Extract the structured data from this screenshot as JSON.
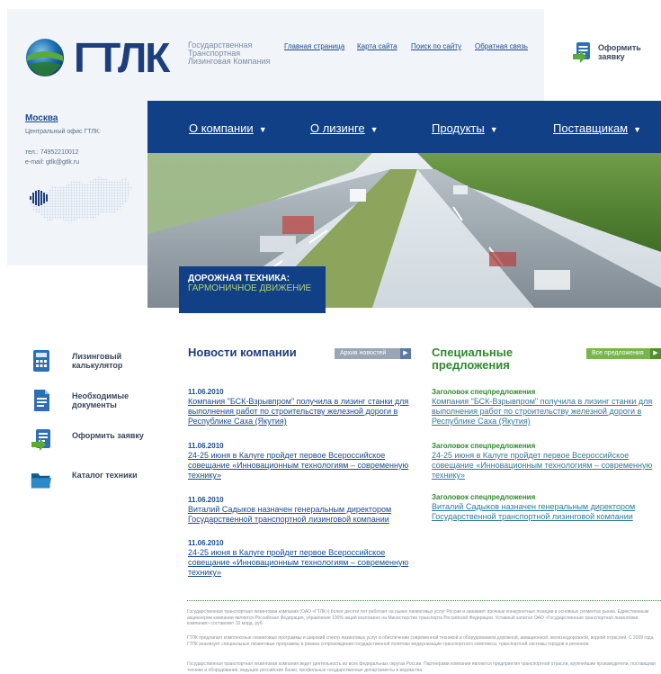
{
  "brand": {
    "logo_text": "ГТЛК",
    "company_name": "Государственная Транспортная Лизинговая Компания"
  },
  "top_links": [
    {
      "label": "Главная страница"
    },
    {
      "label": "Карта сайта"
    },
    {
      "label": "Поиск по сайту"
    },
    {
      "label": "Обратная связь"
    }
  ],
  "order_top": {
    "label": "Оформить заявку"
  },
  "contacts": {
    "city": "Москва",
    "office": "Центральный офис ГТЛК:",
    "phone": "тел.: 74952210012",
    "email": "e-mail: gtlk@gtlk.ru"
  },
  "main_nav": [
    {
      "label": "О компании"
    },
    {
      "label": "О лизинге"
    },
    {
      "label": "Продукты"
    },
    {
      "label": "Поставщикам"
    }
  ],
  "hero": {
    "line1": "ДОРОЖНАЯ ТЕХНИКА:",
    "line2": "ГАРМОНИЧНОЕ ДВИЖЕНИЕ"
  },
  "side_links": [
    {
      "label": "Лизинговый калькулятор",
      "icon": "calculator-icon"
    },
    {
      "label": "Необходимые документы",
      "icon": "document-icon"
    },
    {
      "label": "Оформить заявку",
      "icon": "form-icon"
    },
    {
      "label": "Каталог техники",
      "icon": "folder-icon"
    }
  ],
  "news": {
    "title": "Новости компании",
    "archive_label": "Архив новостей",
    "items": [
      {
        "date": "11.06.2010",
        "text": "Компания \"БСК-Взрывпром\" получила в лизинг станки для выполнения работ по строительству железной дороги в Республике Саха (Якутия)"
      },
      {
        "date": "11.06.2010",
        "text": "24-25 июня в Калуге пройдет первое Всероссийское совещание «Инновационным технологиям – современную технику»"
      },
      {
        "date": "11.06.2010",
        "text": "Виталий Садыков назначен генеральным директором Государственной транспортной лизинговой компании"
      },
      {
        "date": "11.06.2010",
        "text": "24-25 июня в Калуге пройдет первое Всероссийское совещание «Инновационным технологиям – современную технику»"
      }
    ]
  },
  "offers": {
    "title": "Специальные предложения",
    "all_label": "Все предложения",
    "items": [
      {
        "title": "Заголовок спецпредложения",
        "text": "Компания \"БСК-Взрывпром\" получила в лизинг станки для выполнения работ по строительству железной дороги в Республике Саха (Якутия)"
      },
      {
        "title": "Заголовок спецпредложения",
        "text": "24-25 июня в Калуге пройдет первое Всероссийское совещание «Инновационным технологиям – современную технику»"
      },
      {
        "title": "Заголовок спецпредложения",
        "text": "Виталий Садыков назначен генеральным директором Государственной транспортной лизинговой компании"
      }
    ]
  },
  "footer": {
    "p1": "Государственная транспортная лизинговая компания (ОАО «ГТЛК») более десяти лет работает на рынке лизинговых услуг России и занимает прочные конкурентные позиции в основных сегментах рынка. Единственным акционером компании является Российская Федерация, управление 100% акций возложено на Министерство транспорта Российской Федерации. Уставный капитал ОАО «Государственная транспортная лизинговая компания» составляет 10 млрд. руб.",
    "p2": "ГТЛК предлагает комплексные лизинговые программы и широкий спектр лизинговых услуг в обеспечении современной техникой и оборудованием дорожной, авиационной, железнодорожной, водной отраслей. С 2009 года ГТЛК реализует специальные лизинговые программы в рамках сопровождения государственной политики модернизации транспортного комплекса, транспортной системы городов и регионов.",
    "p3": "Государственная транспортная лизинговая компания ведет деятельность во всех федеральных округах России. Партнерами компании являются предприятия транспортной отрасли, крупнейшие производители, поставщики техники и оборудования, ведущие российские банки, профильные государственные департаменты и ведомства."
  },
  "colors": {
    "navy": "#114087",
    "green": "#2f8a2f",
    "button_gray": "#9aa6b6",
    "button_green": "#78b54a"
  }
}
